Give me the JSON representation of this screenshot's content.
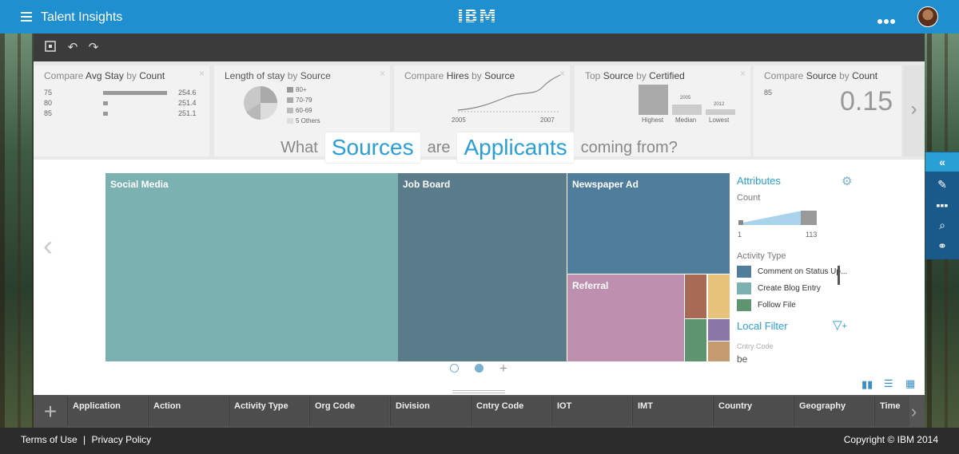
{
  "app": {
    "title": "Talent Insights",
    "brand": "IBM"
  },
  "colors": {
    "accent": "#2a9fd6",
    "topbar": "#1f8fd0"
  },
  "cards": [
    {
      "title_a": "Compare",
      "title_b": "Avg Stay",
      "title_c": "by",
      "title_d": "Count",
      "rows": [
        {
          "label": "75",
          "value": "254.6"
        },
        {
          "label": "80",
          "value": "251.4"
        },
        {
          "label": "85",
          "value": "251.1"
        }
      ]
    },
    {
      "title_a": "Length of stay",
      "title_c": "by",
      "title_d": "Source",
      "legend": [
        "80+",
        "70-79",
        "60-69",
        "5 Others"
      ]
    },
    {
      "title_a": "Compare",
      "title_b": "Hires",
      "title_c": "by",
      "title_d": "Source",
      "x_start": "2005",
      "x_end": "2007"
    },
    {
      "title_a": "Top",
      "title_b": "Source",
      "title_c": "by",
      "title_d": "Certified",
      "bars": [
        {
          "label": "Highest",
          "value": ""
        },
        {
          "label": "Median",
          "value": "2005"
        },
        {
          "label": "Lowest",
          "value": "2012"
        }
      ]
    },
    {
      "title_a": "Compare",
      "title_b": "Source",
      "title_c": "by",
      "title_d": "Count",
      "small_label": "85",
      "big_value": "0.15"
    }
  ],
  "question": {
    "w1": "What",
    "chip1": "Sources",
    "w2": "are",
    "chip2": "Applicants",
    "w3": "coming from?"
  },
  "treemap": [
    {
      "label": "Social Media",
      "color": "#7bb1b0"
    },
    {
      "label": "Job Board",
      "color": "#597b8a"
    },
    {
      "label": "Newspaper Ad",
      "color": "#4f7d9b"
    },
    {
      "label": "Referral",
      "color": "#bf8fb0"
    },
    {
      "label": "",
      "color": "#a86a55"
    },
    {
      "label": "",
      "color": "#e6c27a"
    },
    {
      "label": "",
      "color": "#5e9470"
    },
    {
      "label": "",
      "color": "#8b76a8"
    },
    {
      "label": "",
      "color": "#c49a6e"
    }
  ],
  "attributes": {
    "title": "Attributes",
    "count_label": "Count",
    "count_min": "1",
    "count_max": "113",
    "activity_label": "Activity Type",
    "activity_items": [
      {
        "label": "Comment on Status Up...",
        "color": "#4f7d9b"
      },
      {
        "label": "Create Blog Entry",
        "color": "#7bb1b0"
      },
      {
        "label": "Follow File",
        "color": "#5e9470"
      }
    ],
    "local_filter_title": "Local Filter",
    "filter_field_label": "Cntry Code",
    "filter_field_value": "be"
  },
  "columns": [
    "Application",
    "Action",
    "Activity Type",
    "Org Code",
    "Division",
    "Cntry Code",
    "IOT",
    "IMT",
    "Country",
    "Geography",
    "Time"
  ],
  "footer": {
    "terms": "Terms of Use",
    "sep": "|",
    "privacy": "Privacy Policy",
    "copyright": "Copyright © IBM 2014"
  }
}
